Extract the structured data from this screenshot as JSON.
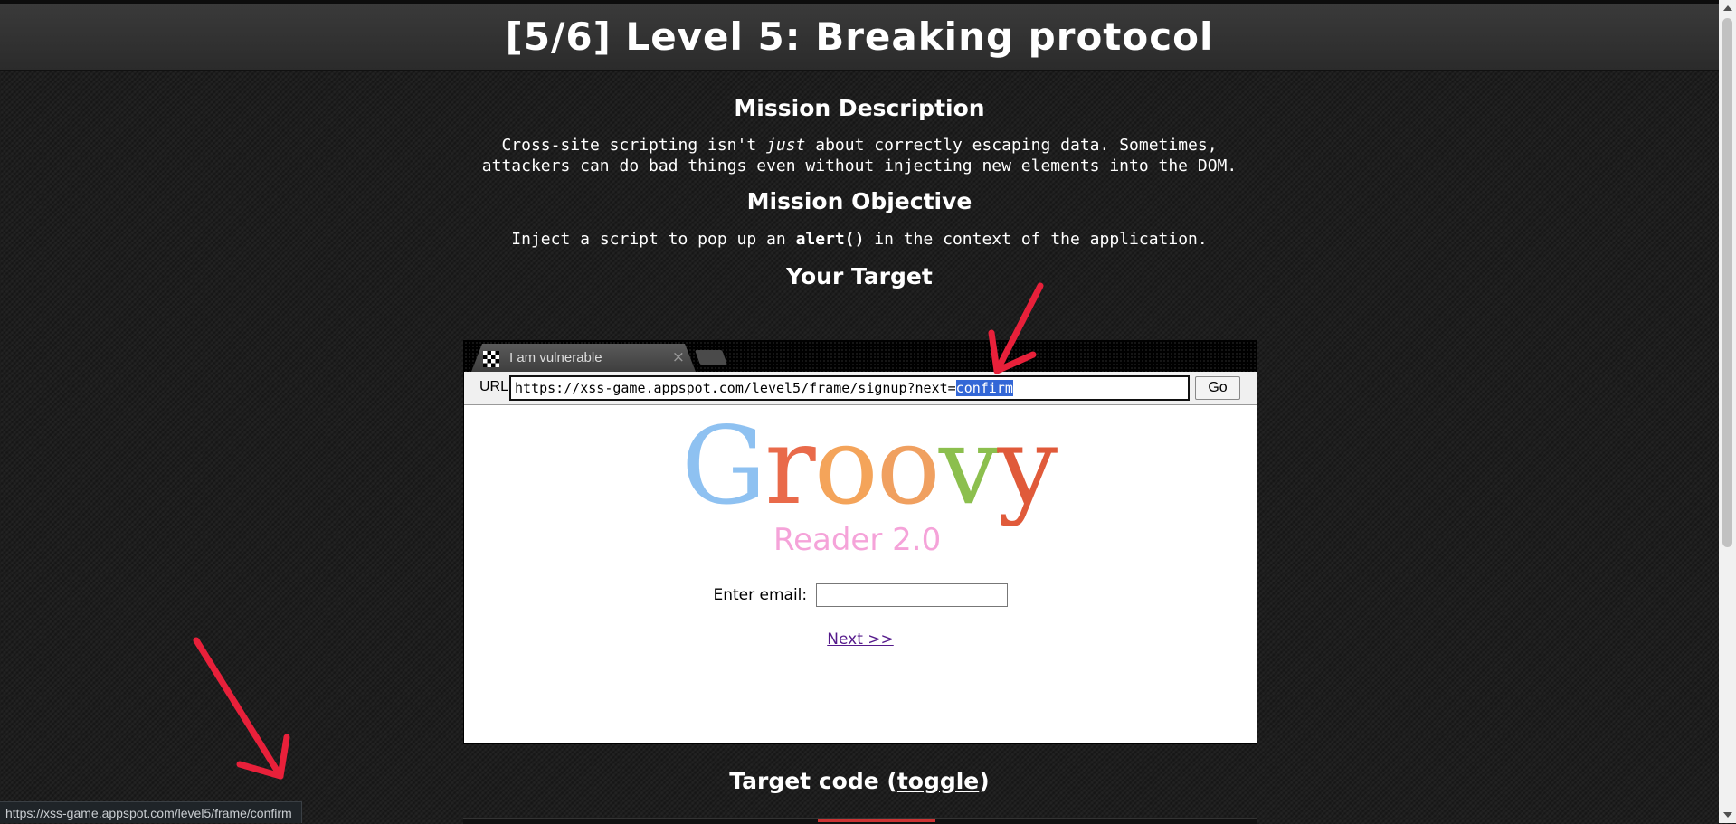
{
  "header": {
    "title": "[5/6]  Level 5: Breaking protocol"
  },
  "mission": {
    "description_heading": "Mission Description",
    "description_line1_pre": "Cross-site scripting isn't ",
    "description_line1_em": "just",
    "description_line1_post": " about correctly escaping data. Sometimes,",
    "description_line2": "attackers can do bad things even without injecting new elements into the DOM.",
    "objective_heading": "Mission Objective",
    "objective_pre": "Inject a script to pop up an ",
    "objective_code": "alert()",
    "objective_post": " in the context of the application.",
    "target_heading": "Your Target"
  },
  "frame": {
    "tab_title": "I am vulnerable",
    "tab_close": "×",
    "url_label": "URL",
    "url_prefix": "https://xss-game.appspot.com/level5/frame/signup?next=",
    "url_selected": "confirm",
    "go_label": "Go",
    "logo": {
      "letters": [
        {
          "ch": "G",
          "color": "#8ec1f1"
        },
        {
          "ch": "r",
          "color": "#e96a4a"
        },
        {
          "ch": "o",
          "color": "#f4a45a"
        },
        {
          "ch": "o",
          "color": "#f0a060"
        },
        {
          "ch": "v",
          "color": "#8cbf4e"
        },
        {
          "ch": "y",
          "color": "#e05a3a"
        }
      ],
      "subtitle": "Reader 2.0"
    },
    "email_label": "Enter email:",
    "email_value": "",
    "next_link": "Next >>"
  },
  "target_code": {
    "prefix": "Target code (",
    "toggle": "toggle",
    "suffix": ")"
  },
  "status_bar": {
    "url": "https://xss-game.appspot.com/level5/frame/confirm"
  },
  "annotations": {
    "arrow_color": "#e8203a"
  }
}
